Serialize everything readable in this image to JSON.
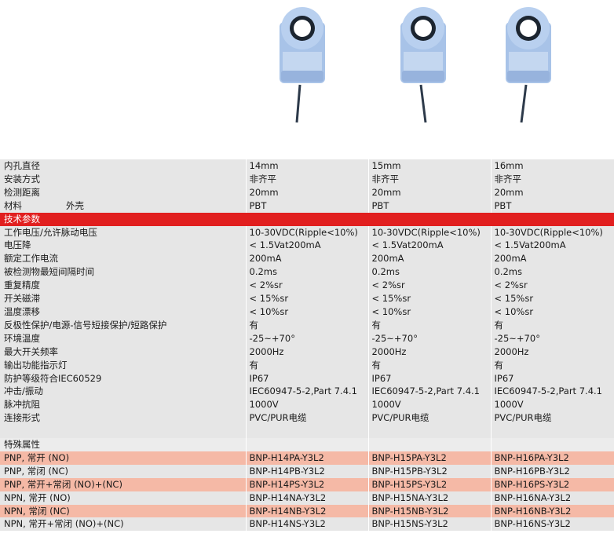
{
  "products": [
    {
      "name": "product-photo-14mm"
    },
    {
      "name": "product-photo-15mm"
    },
    {
      "name": "product-photo-16mm"
    }
  ],
  "colors": {
    "header_red": "#e11f1f",
    "row_gray": "#e6e6e6",
    "row_pink": "#f5b9a6",
    "sensor_body": "#a8c3e8"
  },
  "rows": [
    {
      "label": "内孔直径",
      "values": [
        "14mm",
        "15mm",
        "16mm"
      ]
    },
    {
      "label": "安装方式",
      "values": [
        "非齐平",
        "非齐平",
        "非齐平"
      ]
    },
    {
      "label": "检测距离",
      "values": [
        "20mm",
        "20mm",
        "20mm"
      ]
    },
    {
      "label": "材料",
      "sub": "外壳",
      "values": [
        "PBT",
        "PBT",
        "PBT"
      ]
    },
    {
      "label": "技术参数",
      "values": [
        "",
        "",
        ""
      ]
    },
    {
      "label": "工作电压/允许脉动电压",
      "values": [
        "10-30VDC(Ripple<10%)",
        "10-30VDC(Ripple<10%)",
        "10-30VDC(Ripple<10%)"
      ]
    },
    {
      "label": "电压降",
      "values": [
        "< 1.5Vat200mA",
        "< 1.5Vat200mA",
        "< 1.5Vat200mA"
      ]
    },
    {
      "label": "额定工作电流",
      "values": [
        "200mA",
        "200mA",
        "200mA"
      ]
    },
    {
      "label": "被检测物最短间隔时间",
      "values": [
        "0.2ms",
        "0.2ms",
        "0.2ms"
      ]
    },
    {
      "label": "重复精度",
      "values": [
        "< 2%sr",
        "< 2%sr",
        "< 2%sr"
      ]
    },
    {
      "label": "开关磁滞",
      "values": [
        "< 15%sr",
        "< 15%sr",
        "< 15%sr"
      ]
    },
    {
      "label": "温度漂移",
      "values": [
        "< 10%sr",
        "< 10%sr",
        "< 10%sr"
      ]
    },
    {
      "label": "反极性保护/电源-信号短接保护/短路保护",
      "values": [
        "有",
        "有",
        "有"
      ]
    },
    {
      "label": "环境温度",
      "values": [
        "-25~+70°",
        "-25~+70°",
        "-25~+70°"
      ]
    },
    {
      "label": "最大开关频率",
      "values": [
        "2000Hz",
        "2000Hz",
        "2000Hz"
      ]
    },
    {
      "label": "输出功能指示灯",
      "values": [
        "有",
        "有",
        "有"
      ]
    },
    {
      "label": "防护等级符合IEC60529",
      "values": [
        "IP67",
        "IP67",
        "IP67"
      ]
    },
    {
      "label": "冲击/振动",
      "values": [
        "IEC60947-5-2,Part 7.4.1",
        "IEC60947-5-2,Part 7.4.1",
        "IEC60947-5-2,Part 7.4.1"
      ]
    },
    {
      "label": "脉冲抗阻",
      "values": [
        "1000V",
        "1000V",
        "1000V"
      ]
    },
    {
      "label": "连接形式",
      "values": [
        "PVC/PUR电缆",
        "PVC/PUR电缆",
        "PVC/PUR电缆"
      ]
    },
    {
      "label": "",
      "values": [
        "",
        "",
        ""
      ]
    },
    {
      "label": "特殊属性",
      "values": [
        "",
        "",
        ""
      ]
    },
    {
      "label": "PNP, 常开 (NO)",
      "values": [
        "BNP-H14PA-Y3L2",
        "BNP-H15PA-Y3L2",
        "BNP-H16PA-Y3L2"
      ]
    },
    {
      "label": "PNP, 常闭 (NC)",
      "values": [
        "BNP-H14PB-Y3L2",
        "BNP-H15PB-Y3L2",
        "BNP-H16PB-Y3L2"
      ]
    },
    {
      "label": "PNP, 常开+常闭 (NO)+(NC)",
      "values": [
        "BNP-H14PS-Y3L2",
        "BNP-H15PS-Y3L2",
        "BNP-H16PS-Y3L2"
      ]
    },
    {
      "label": "NPN, 常开 (NO)",
      "values": [
        "BNP-H14NA-Y3L2",
        "BNP-H15NA-Y3L2",
        "BNP-H16NA-Y3L2"
      ]
    },
    {
      "label": "NPN, 常闭 (NC)",
      "values": [
        "BNP-H14NB-Y3L2",
        "BNP-H15NB-Y3L2",
        "BNP-H16NB-Y3L2"
      ]
    },
    {
      "label": "NPN, 常开+常闭 (NO)+(NC)",
      "values": [
        "BNP-H14NS-Y3L2",
        "BNP-H15NS-Y3L2",
        "BNP-H16NS-Y3L2"
      ]
    }
  ]
}
